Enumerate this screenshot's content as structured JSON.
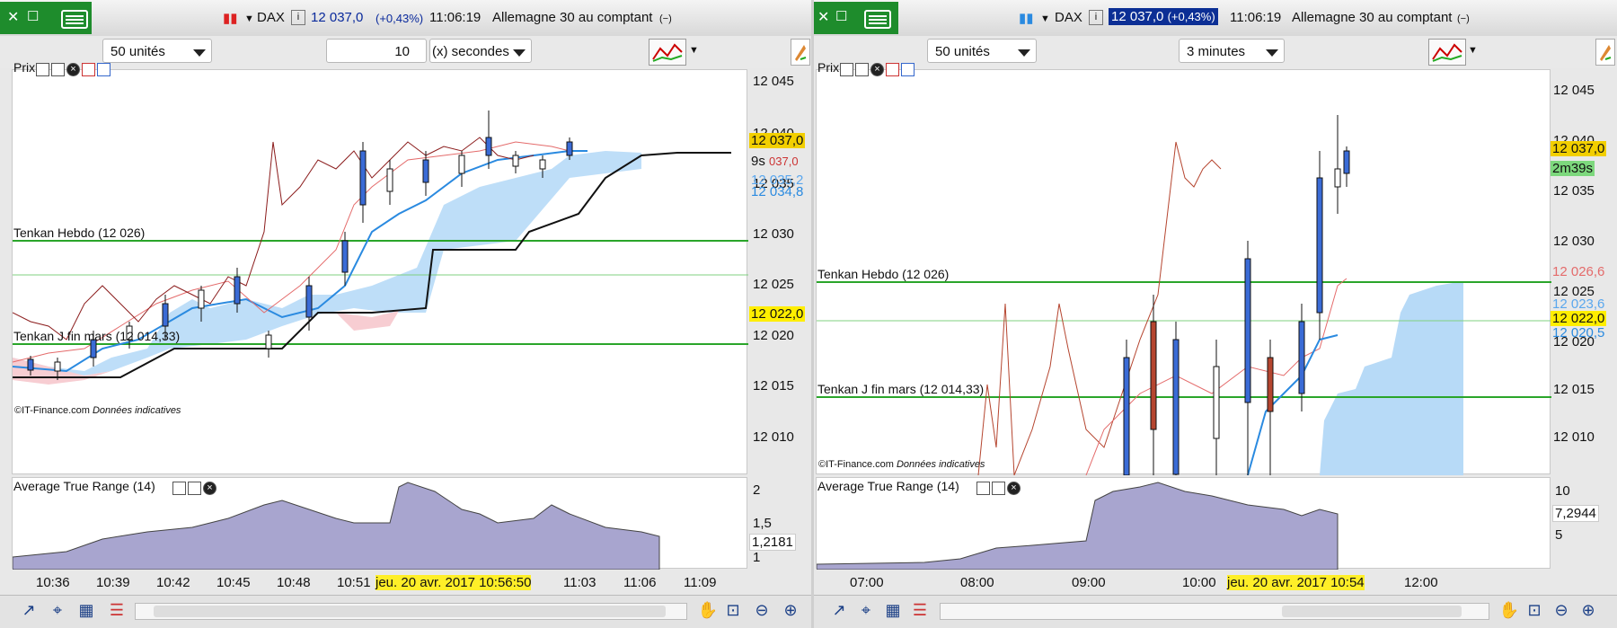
{
  "left": {
    "title": {
      "symbol": "DAX",
      "price": "12 037,0",
      "change": "(+0,43%)",
      "time": "11:06:19",
      "description": "Allemagne 30 au comptant",
      "suffix": "(−)"
    },
    "toolbar": {
      "units": "50 unités",
      "interval_value": "10",
      "interval_unit": "(x) secondes"
    },
    "price_panel": {
      "label": "Prix",
      "copyright": "©IT-Finance.com",
      "note": "Données indicatives",
      "hline_hebdo": "Tenkan Hebdo (12 026)",
      "hline_j": "Tenkan J fin mars (12 014,33)"
    },
    "y_axis": [
      "12 045",
      "12 040",
      "12 035",
      "12 030",
      "12 025",
      "12 020",
      "12 015",
      "12 010"
    ],
    "tags": {
      "price": "12 037,0",
      "countdown": "9s",
      "red_tag": "037,0",
      "blue_tag1": "12 035,2",
      "blue_tag2": "12 034,8",
      "level": "12 022,0"
    },
    "atr_panel": {
      "label": "Average True Range (14)",
      "y_axis": [
        "2",
        "1,5",
        "1"
      ],
      "value": "1,2181"
    },
    "x_axis": [
      "10:36",
      "10:39",
      "10:42",
      "10:45",
      "10:48",
      "10:51",
      "11:03",
      "11:06",
      "11:09"
    ],
    "cursor_date": "jeu. 20 avr. 2017 10:56:50"
  },
  "right": {
    "title": {
      "symbol": "DAX",
      "price": "12 037,0",
      "change": "(+0,43%)",
      "time": "11:06:19",
      "description": "Allemagne 30 au comptant",
      "suffix": "(−)"
    },
    "toolbar": {
      "units": "50 unités",
      "interval": "3 minutes"
    },
    "price_panel": {
      "label": "Prix",
      "copyright": "©IT-Finance.com",
      "note": "Données indicatives",
      "hline_hebdo": "Tenkan Hebdo (12 026)",
      "hline_j": "Tenkan J fin mars (12 014,33)"
    },
    "y_axis": [
      "12 045",
      "12 040",
      "12 035",
      "12 030",
      "12 025",
      "12 020",
      "12 015",
      "12 010"
    ],
    "tags": {
      "price": "12 037,0",
      "countdown": "2m39s",
      "red_tag": "12 026,6",
      "blue_tag1": "12 023,6",
      "blue_tag2": "12 020,5",
      "level": "12 022,0"
    },
    "atr_panel": {
      "label": "Average True Range (14)",
      "y_axis": [
        "10",
        "5"
      ],
      "value": "7,2944"
    },
    "x_axis": [
      "07:00",
      "08:00",
      "09:00",
      "10:00",
      "12:00"
    ],
    "cursor_date": "jeu. 20 avr. 2017 10:54"
  },
  "colors": {
    "green_line": "#2aa52a",
    "candle_up": "#3a6bd6",
    "candle_down": "#b5452f",
    "kijun": "#111111",
    "tenkan": "#2a8ae0",
    "chikou": "#8b1c1c",
    "cloud": "#b7daf7",
    "cloud_red": "#f7cdd2",
    "atr_fill": "#a8a5cf",
    "price_tag": "#f2cf00",
    "level_tag": "#ffee00",
    "countdown_tag": "#7dd87d"
  },
  "icons": [
    "close-icon",
    "restore-icon",
    "keyboard-icon",
    "candle-icon",
    "info-icon",
    "indicators-icon",
    "drawing-icon",
    "wrench-icon",
    "window-icon",
    "down-arrow-icon",
    "up-arrow-icon",
    "zoom-icon",
    "zoom-out-icon",
    "zoom-in-icon"
  ]
}
